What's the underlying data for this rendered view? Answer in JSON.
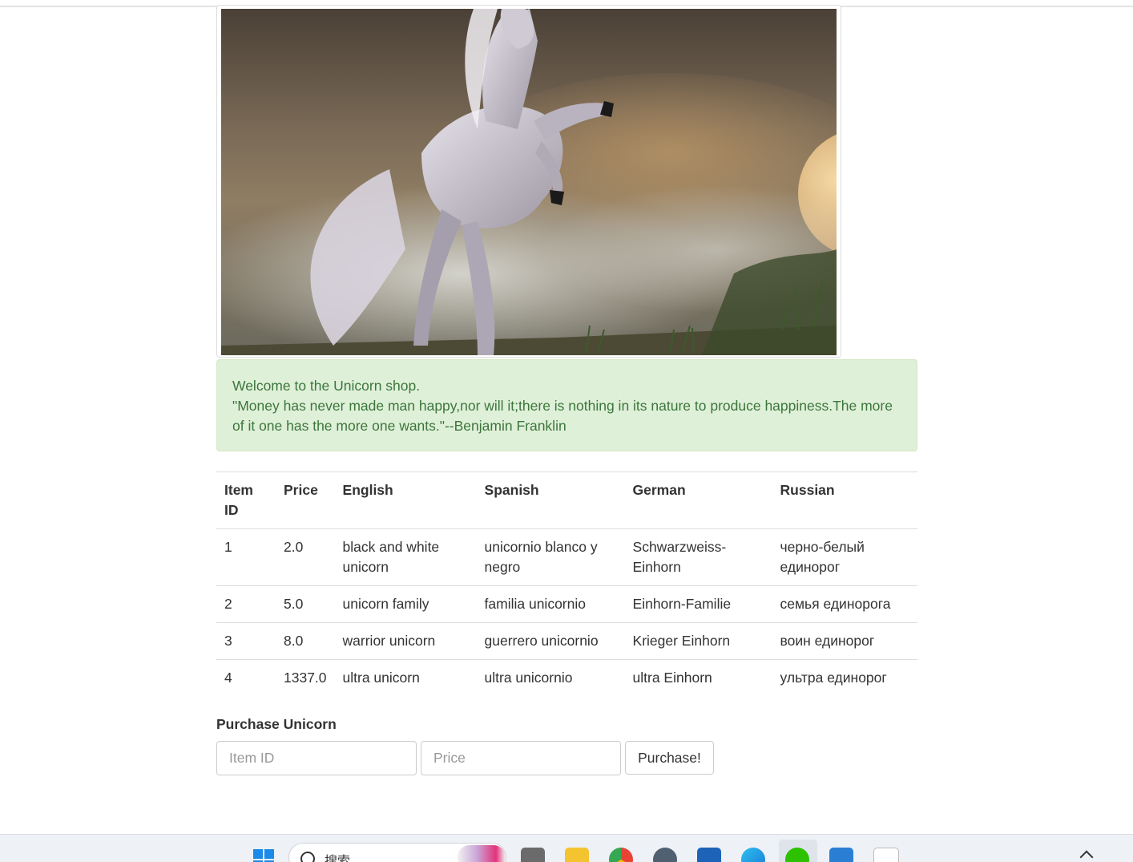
{
  "alert": {
    "welcome": "Welcome to the Unicorn shop.",
    "quote": "\"Money has never made man happy,nor will it;there is nothing in its nature to produce happiness.The more of it one has the more one wants.\"--Benjamin Franklin"
  },
  "table": {
    "headers": {
      "item_id": "Item ID",
      "price": "Price",
      "english": "English",
      "spanish": "Spanish",
      "german": "German",
      "russian": "Russian"
    },
    "rows": [
      {
        "id": "1",
        "price": "2.0",
        "english": "black and white unicorn",
        "spanish": "unicornio blanco y negro",
        "german": "Schwarzweiss-Einhorn",
        "russian": "черно-белый единорог"
      },
      {
        "id": "2",
        "price": "5.0",
        "english": "unicorn family",
        "spanish": "familia unicornio",
        "german": "Einhorn-Familie",
        "russian": "семья единорога"
      },
      {
        "id": "3",
        "price": "8.0",
        "english": "warrior unicorn",
        "spanish": "guerrero unicornio",
        "german": "Krieger Einhorn",
        "russian": "воин единорог"
      },
      {
        "id": "4",
        "price": "1337.0",
        "english": "ultra unicorn",
        "spanish": "ultra unicornio",
        "german": "ultra Einhorn",
        "russian": "ультра единорог"
      }
    ]
  },
  "purchase": {
    "title": "Purchase Unicorn",
    "item_id_placeholder": "Item ID",
    "price_placeholder": "Price",
    "button_label": "Purchase!"
  },
  "taskbar": {
    "search_text": "搜索",
    "icons": [
      "windows-start-icon",
      "file-explorer-icon",
      "folder-icon",
      "chrome-icon",
      "app-icon",
      "store-icon",
      "edge-icon",
      "wechat-icon",
      "remote-desktop-icon",
      "typora-icon"
    ]
  }
}
